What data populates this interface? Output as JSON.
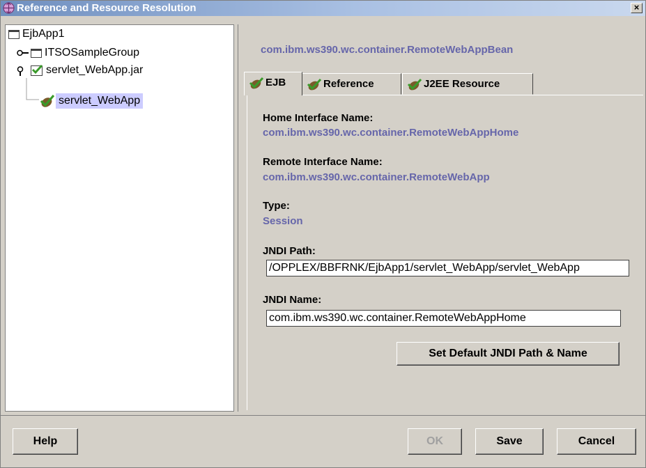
{
  "window": {
    "title": "Reference and Resource Resolution",
    "close_glyph": "×"
  },
  "tree": {
    "items": [
      {
        "label": "EjbApp1",
        "icon": "folder-icon"
      },
      {
        "label": "ITSOSampleGroup",
        "icon": "folder-icon"
      },
      {
        "label": "servlet_WebApp.jar",
        "icon": "checked-folder-icon"
      },
      {
        "label": "servlet_WebApp",
        "icon": "check-icon",
        "selected": true
      }
    ]
  },
  "detail": {
    "bean_name": "com.ibm.ws390.wc.container.RemoteWebAppBean",
    "tabs": [
      {
        "label": "EJB",
        "active": true
      },
      {
        "label": "Reference",
        "active": false
      },
      {
        "label": "J2EE Resource",
        "active": false
      }
    ],
    "home_interface_label": "Home Interface Name:",
    "home_interface_value": "com.ibm.ws390.wc.container.RemoteWebAppHome",
    "remote_interface_label": "Remote Interface Name:",
    "remote_interface_value": "com.ibm.ws390.wc.container.RemoteWebApp",
    "type_label": "Type:",
    "type_value": "Session",
    "jndi_path_label": "JNDI Path:",
    "jndi_path_value": "/OPPLEX/BBFRNK/EjbApp1/servlet_WebApp/servlet_WebApp",
    "jndi_name_label": "JNDI Name:",
    "jndi_name_value": "com.ibm.ws390.wc.container.RemoteWebAppHome",
    "set_default_label": "Set Default JNDI Path & Name"
  },
  "footer": {
    "help_label": "Help",
    "ok_label": "OK",
    "save_label": "Save",
    "cancel_label": "Cancel"
  },
  "colors": {
    "title_bar": "#6f8fbf",
    "value_text": "#6666aa",
    "selection": "#ccccff",
    "check_green": "#3a9a2a"
  }
}
